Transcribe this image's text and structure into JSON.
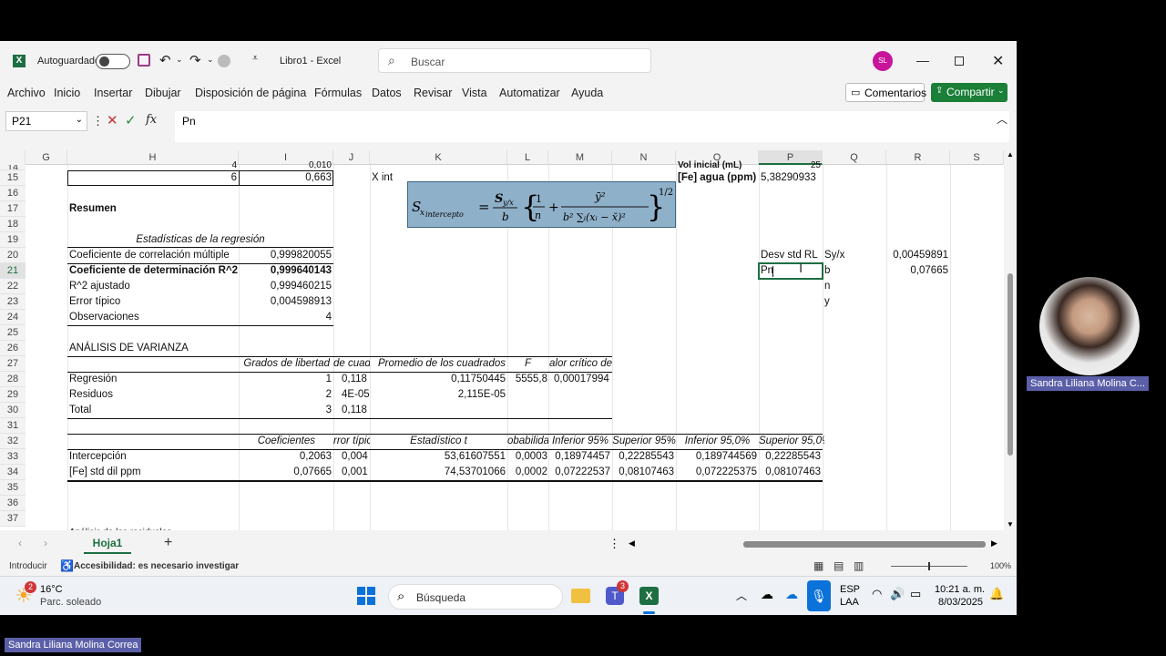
{
  "titlebar": {
    "autosave_label": "Autoguardado",
    "doc_title": "Libro1  -  Excel",
    "search_placeholder": "Buscar",
    "user_initials": "SL"
  },
  "menu": [
    "Archivo",
    "Inicio",
    "Insertar",
    "Dibujar",
    "Disposición de página",
    "Fórmulas",
    "Datos",
    "Revisar",
    "Vista",
    "Automatizar",
    "Ayuda"
  ],
  "ribbon_right": {
    "comments": "Comentarios",
    "share": "Compartir"
  },
  "formula_bar": {
    "name_box": "P21",
    "fx": "fx",
    "content": "Pn"
  },
  "columns": [
    "G",
    "H",
    "I",
    "J",
    "K",
    "L",
    "M",
    "N",
    "O",
    "P",
    "Q",
    "R",
    "S"
  ],
  "rows": [
    "14",
    "15",
    "16",
    "17",
    "18",
    "19",
    "20",
    "21",
    "22",
    "23",
    "24",
    "25",
    "26",
    "27",
    "28",
    "29",
    "30",
    "31",
    "32",
    "33",
    "34",
    "35",
    "36",
    "37"
  ],
  "cells": {
    "i14": "4",
    "i14b": "0,010",
    "h15": "6",
    "i15": "0,663",
    "k15": "X int",
    "o14": "Vol inicial (mL)",
    "p14": "25",
    "o15": "[Fe] agua  (ppm)",
    "p15": "5,38290933",
    "resumen": "Resumen",
    "stats_title": "Estadísticas de la regresión",
    "s1_label": "Coeficiente de correlación múltiple",
    "s1_val": "0,999820055",
    "s2_label": "Coeficiente de determinación R^2",
    "s2_val": "0,999640143",
    "s3_label": "R^2  ajustado",
    "s3_val": "0,999460215",
    "s4_label": "Error típico",
    "s4_val": "0,004598913",
    "s5_label": "Observaciones",
    "s5_val": "4",
    "anova_title": "ANÁLISIS DE VARIANZA",
    "a_h1": "Grados de libertad",
    "a_h2": "de cuad",
    "a_h3": "Promedio de los cuadrados",
    "a_h4": "F",
    "a_h5": "alor crítico de F",
    "a_r1": "Regresión",
    "a_r1_gl": "1",
    "a_r1_sc": "0,118",
    "a_r1_pc": "0,11750445",
    "a_r1_f": "5555,8",
    "a_r1_vc": "0,00017994",
    "a_r2": "Residuos",
    "a_r2_gl": "2",
    "a_r2_sc": "4E-05",
    "a_r2_pc": "2,115E-05",
    "a_r3": "Total",
    "a_r3_gl": "3",
    "a_r3_sc": "0,118",
    "c_h1": "Coeficientes",
    "c_h2": "rror típic",
    "c_h3": "Estadístico t",
    "c_h4": "obabilida",
    "c_h5": "Inferior 95%",
    "c_h6": "Superior 95%",
    "c_h7": "Inferior 95,0%",
    "c_h8": "Superior 95,0%",
    "c_r1": "Intercepción",
    "c_r1_v1": "0,2063",
    "c_r1_v2": "0,004",
    "c_r1_v3": "53,61607551",
    "c_r1_v4": "0,0003",
    "c_r1_v5": "0,18974457",
    "c_r1_v6": "0,22285543",
    "c_r1_v7": "0,189744569",
    "c_r1_v8": "0,22285543",
    "c_r2": "[Fe] std dil ppm",
    "c_r2_v1": "0,07665",
    "c_r2_v2": "0,001",
    "c_r2_v3": "74,53701066",
    "c_r2_v4": "0,0002",
    "c_r2_v5": "0,07222537",
    "c_r2_v6": "0,08107463",
    "c_r2_v7": "0,072225375",
    "c_r2_v8": "0,08107463",
    "p20": "Desv std RL",
    "q20": "Sy/x",
    "r20": "0,00459891",
    "p21": "Pn",
    "q21": "b",
    "r21": "0,07665",
    "q22": "n",
    "q23": "y",
    "row37": "Análisis de los residuales"
  },
  "sheet_tab": "Hoja1",
  "status": {
    "mode": "Introducir",
    "accessibility": "Accesibilidad: es necesario investigar",
    "zoom": "100%"
  },
  "taskbar": {
    "weather_temp": "16°C",
    "weather_desc": "Parc. soleado",
    "weather_badge": "2",
    "search": "Búsqueda",
    "teams_badge": "3",
    "lang1": "ESP",
    "lang2": "LAA",
    "time": "10:21 a. m.",
    "date": "8/03/2025"
  },
  "participant_name": "Sandra Liliana Molina C...",
  "presenter_name": "Sandra Liliana Molina Correa"
}
